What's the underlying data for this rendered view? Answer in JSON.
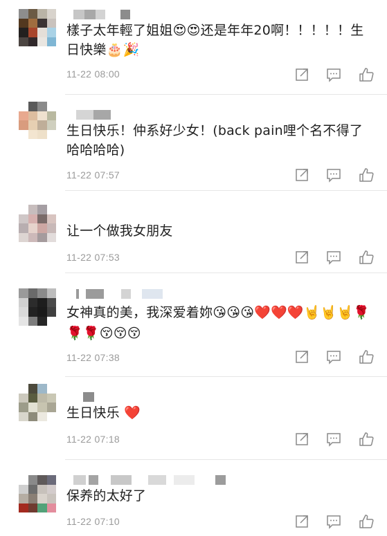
{
  "comments": [
    {
      "text": "樣子太年輕了姐姐😍😍还是年年20啊！！！！！生日快樂🎂🎉",
      "time": "11-22 08:00"
    },
    {
      "text": "生日快乐！仲系好少女！(back pain哩个名不得了哈哈哈哈)",
      "time": "11-22 07:57"
    },
    {
      "text": "让一个做我女朋友",
      "time": "11-22 07:53"
    },
    {
      "text": "女神真的美，我深爱着妳😘😘😘❤️❤️❤️🤘🤘🤘🌹🌹🌹😚😚😚",
      "time": "11-22 07:38"
    },
    {
      "text": "生日快乐 ❤️",
      "time": "11-22 07:18"
    },
    {
      "text": "保养的太好了",
      "time": "11-22 07:10"
    }
  ],
  "icons": {
    "share": "share-icon",
    "comment": "comment-icon",
    "like": "thumbs-up-icon"
  },
  "colors": {
    "text": "#1f1f1f",
    "timestamp": "#9a9a9a",
    "icon": "#8a8a8a",
    "separator": "#e6e6e6",
    "heart": "#e8232b"
  }
}
